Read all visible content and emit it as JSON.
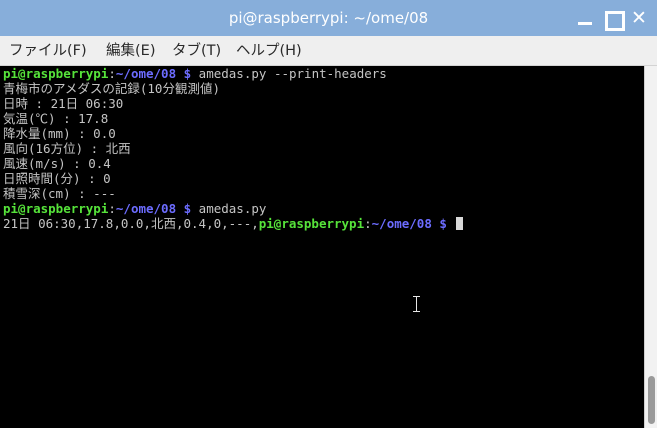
{
  "window": {
    "title": "pi@raspberrypi: ~/ome/08",
    "buttons": {
      "minimize": "minimize-icon",
      "maximize": "maximize-icon",
      "close": "close-icon",
      "close_glyph": "✕"
    }
  },
  "menu": [
    {
      "label": "ファイル(F)"
    },
    {
      "label": "編集(E)"
    },
    {
      "label": "タブ(T)"
    },
    {
      "label": "ヘルプ(H)"
    }
  ],
  "terminal": {
    "prompt_user": "pi@raspberrypi",
    "prompt_sep": ":",
    "prompt_path": "~/ome/08 $",
    "lines": [
      {
        "cmd": " amedas.py --print-headers"
      },
      {
        "text": "青梅市のアメダスの記録(10分観測値)"
      },
      {
        "text": "日時 : 21日 06:30"
      },
      {
        "text": "気温(℃) : 17.8"
      },
      {
        "text": "降水量(mm) : 0.0"
      },
      {
        "text": "風向(16方位) : 北西"
      },
      {
        "text": "風速(m/s) : 0.4"
      },
      {
        "text": "日照時間(分) : 0"
      },
      {
        "text": "積雪深(cm) : ---"
      },
      {
        "cmd": " amedas.py"
      },
      {
        "text": "21日 06:30,17.8,0.0,北西,0.4,0,---,"
      }
    ],
    "colors": {
      "user": "#56e33a",
      "path": "#6c6cff",
      "text": "#c4c4c4",
      "background": "#000000"
    }
  }
}
